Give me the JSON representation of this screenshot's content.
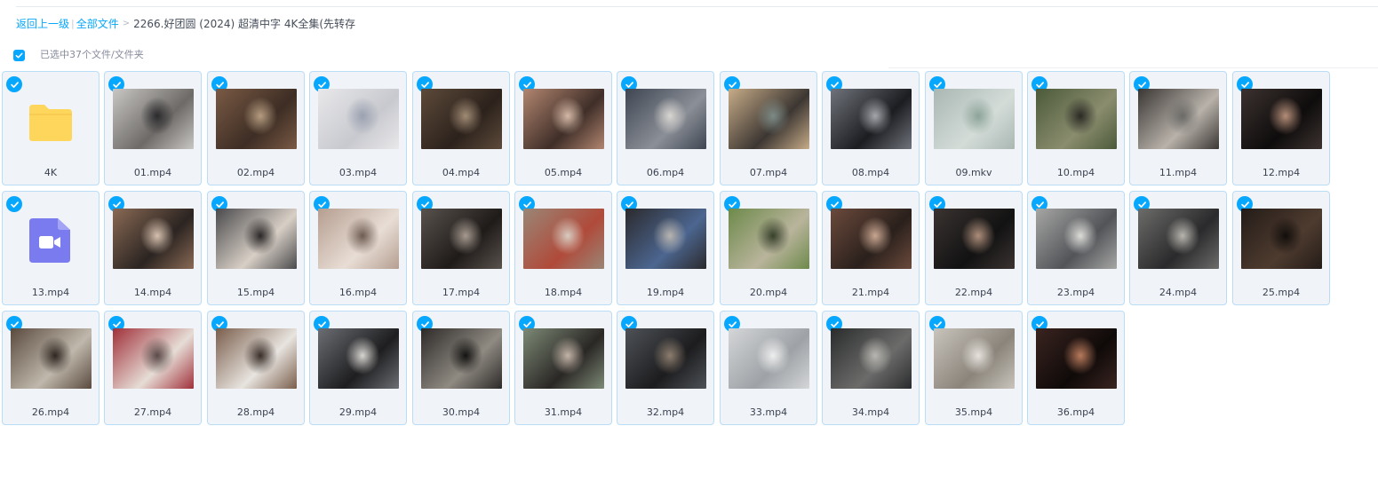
{
  "breadcrumb": {
    "back_label": "返回上一级",
    "separator": "|",
    "all_files_label": "全部文件",
    "arrow": ">",
    "current_label": "2266.好团圆 (2024) 超清中字 4K全集(先转存再..."
  },
  "selection": {
    "checked": true,
    "label": "已选中37个文件/文件夹"
  },
  "colors": {
    "accent": "#06a7ff",
    "card_background": "#f0f3f8",
    "card_border": "#b9ddf7",
    "folder": "#ffd65c",
    "video_icon": "#7b7bf0"
  },
  "files": [
    {
      "name": "4K",
      "kind": "folder",
      "icon": "folder-icon",
      "selected": true
    },
    {
      "name": "01.mp4",
      "kind": "video",
      "selected": true,
      "thumb": [
        "#c9c7c3",
        "#6d6a67",
        "#2b2a2c"
      ]
    },
    {
      "name": "02.mp4",
      "kind": "video",
      "selected": true,
      "thumb": [
        "#7a5a45",
        "#3d2d24",
        "#b59c80"
      ]
    },
    {
      "name": "03.mp4",
      "kind": "video",
      "selected": true,
      "thumb": [
        "#e8e8ea",
        "#c8c9cf",
        "#9aa1b0"
      ]
    },
    {
      "name": "04.mp4",
      "kind": "video",
      "selected": true,
      "thumb": [
        "#5d4a3a",
        "#2c221c",
        "#a08b74"
      ]
    },
    {
      "name": "05.mp4",
      "kind": "video",
      "selected": true,
      "thumb": [
        "#b28670",
        "#3f2e28",
        "#d4b8a6"
      ]
    },
    {
      "name": "06.mp4",
      "kind": "video",
      "selected": true,
      "thumb": [
        "#3e4652",
        "#8b8f97",
        "#d9d6d2"
      ]
    },
    {
      "name": "07.mp4",
      "kind": "video",
      "selected": true,
      "thumb": [
        "#c7ac88",
        "#3c3632",
        "#7c8a86"
      ]
    },
    {
      "name": "08.mp4",
      "kind": "video",
      "selected": true,
      "thumb": [
        "#70737b",
        "#1c1d21",
        "#a5a6ab"
      ]
    },
    {
      "name": "09.mkv",
      "kind": "video",
      "selected": true,
      "thumb": [
        "#a9b7b3",
        "#d4dcd8",
        "#8da49a"
      ]
    },
    {
      "name": "10.mp4",
      "kind": "video",
      "selected": true,
      "thumb": [
        "#4b5a3a",
        "#8a8d6e",
        "#2c2a25"
      ]
    },
    {
      "name": "11.mp4",
      "kind": "video",
      "selected": true,
      "thumb": [
        "#3a3633",
        "#b8b2aa",
        "#6b6a68"
      ]
    },
    {
      "name": "12.mp4",
      "kind": "video",
      "selected": true,
      "thumb": [
        "#3c3230",
        "#0e0c0c",
        "#b48d78"
      ]
    },
    {
      "name": "13.mp4",
      "kind": "video-file",
      "icon": "video-file-icon",
      "selected": true
    },
    {
      "name": "14.mp4",
      "kind": "video",
      "selected": true,
      "thumb": [
        "#8a6a55",
        "#2b2421",
        "#d6c0ae"
      ]
    },
    {
      "name": "15.mp4",
      "kind": "video",
      "selected": true,
      "thumb": [
        "#4a4a4c",
        "#d8cfc6",
        "#2a2727"
      ]
    },
    {
      "name": "16.mp4",
      "kind": "video",
      "selected": true,
      "thumb": [
        "#b59e90",
        "#e8ddd5",
        "#6e5c52"
      ]
    },
    {
      "name": "17.mp4",
      "kind": "video",
      "selected": true,
      "thumb": [
        "#59524d",
        "#1f1b19",
        "#a69a90"
      ]
    },
    {
      "name": "18.mp4",
      "kind": "video",
      "selected": true,
      "thumb": [
        "#9a8676",
        "#b04a3a",
        "#d8cbc0"
      ]
    },
    {
      "name": "19.mp4",
      "kind": "video",
      "selected": true,
      "thumb": [
        "#2b2a2d",
        "#4c6690",
        "#b7b4b0"
      ]
    },
    {
      "name": "20.mp4",
      "kind": "video",
      "selected": true,
      "thumb": [
        "#6d8a4a",
        "#b9b49c",
        "#37402b"
      ]
    },
    {
      "name": "21.mp4",
      "kind": "video",
      "selected": true,
      "thumb": [
        "#6b4a3c",
        "#2a201c",
        "#c9a691"
      ]
    },
    {
      "name": "22.mp4",
      "kind": "video",
      "selected": true,
      "thumb": [
        "#3a3331",
        "#121212",
        "#ad8d7a"
      ]
    },
    {
      "name": "23.mp4",
      "kind": "video",
      "selected": true,
      "thumb": [
        "#a6a6a4",
        "#525458",
        "#dcdcd8"
      ]
    },
    {
      "name": "24.mp4",
      "kind": "video",
      "selected": true,
      "thumb": [
        "#6c6c6a",
        "#2a2a2c",
        "#b8b5ae"
      ]
    },
    {
      "name": "25.mp4",
      "kind": "video",
      "selected": true,
      "thumb": [
        "#241c18",
        "#4e3b2f",
        "#120e0c"
      ]
    },
    {
      "name": "26.mp4",
      "kind": "video",
      "selected": true,
      "thumb": [
        "#5a4a3e",
        "#c0b8ac",
        "#2e2620"
      ]
    },
    {
      "name": "27.mp4",
      "kind": "video",
      "selected": true,
      "thumb": [
        "#a0303a",
        "#e6ddd6",
        "#5a4a48"
      ]
    },
    {
      "name": "28.mp4",
      "kind": "video",
      "selected": true,
      "thumb": [
        "#7a5e4c",
        "#e8e4df",
        "#3a2e28"
      ]
    },
    {
      "name": "29.mp4",
      "kind": "video",
      "selected": true,
      "thumb": [
        "#6b6e73",
        "#1e1e20",
        "#d7d4d0"
      ]
    },
    {
      "name": "30.mp4",
      "kind": "video",
      "selected": true,
      "thumb": [
        "#2c2a28",
        "#8f8a82",
        "#141312"
      ]
    },
    {
      "name": "31.mp4",
      "kind": "video",
      "selected": true,
      "thumb": [
        "#7d8a76",
        "#2a2725",
        "#c2b3a6"
      ]
    },
    {
      "name": "32.mp4",
      "kind": "video",
      "selected": true,
      "thumb": [
        "#4e5257",
        "#1c1c1e",
        "#8c7d6e"
      ]
    },
    {
      "name": "33.mp4",
      "kind": "video",
      "selected": true,
      "thumb": [
        "#d4d6d8",
        "#9ea2a6",
        "#eeeeee"
      ]
    },
    {
      "name": "34.mp4",
      "kind": "video",
      "selected": true,
      "thumb": [
        "#2a2b2c",
        "#6b6c6a",
        "#b8b6b2"
      ]
    },
    {
      "name": "35.mp4",
      "kind": "video",
      "selected": true,
      "thumb": [
        "#c9c4bc",
        "#8a847b",
        "#e6e2dc"
      ]
    },
    {
      "name": "36.mp4",
      "kind": "video",
      "selected": true,
      "thumb": [
        "#3a2420",
        "#0f0a09",
        "#b87a5c"
      ]
    }
  ]
}
